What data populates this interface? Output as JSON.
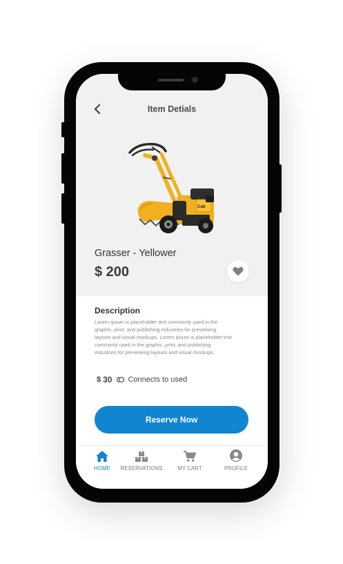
{
  "header": {
    "title": "Item Detials",
    "back_icon": "chevron-left-icon"
  },
  "product": {
    "image": "yellow-tiller-image",
    "name": "Grasser - Yellower",
    "price": "$ 200",
    "favorite_icon": "heart-icon"
  },
  "description": {
    "title": "Description",
    "body": "Lorem ipsum is placeholder text commonly used in the graphic, print, and publishing industries for previewing layouts and visual mockups. Lorem ipsum is placeholder text commonly used in the graphic, print, and publishing industries for previewing layouts and visual mockups."
  },
  "deposit": {
    "currency": "$",
    "amount": "30",
    "label": "Connects to used"
  },
  "actions": {
    "reserve_label": "Reserve Now"
  },
  "tabbar": {
    "items": [
      {
        "label": "HOME",
        "icon": "home-icon",
        "active": true
      },
      {
        "label": "RESERVATIONS",
        "icon": "boxes-icon",
        "active": false
      },
      {
        "label": "MY CART",
        "icon": "cart-icon",
        "active": false
      },
      {
        "label": "PROFILE",
        "icon": "profile-icon",
        "active": false
      }
    ]
  },
  "colors": {
    "accent": "#1185cf",
    "top_background": "#f1f1f1",
    "text_dark": "#3c3c3c",
    "text_muted": "#8a8a8a",
    "phone_frame": "#050505",
    "product_yellow": "#f2b01e"
  }
}
